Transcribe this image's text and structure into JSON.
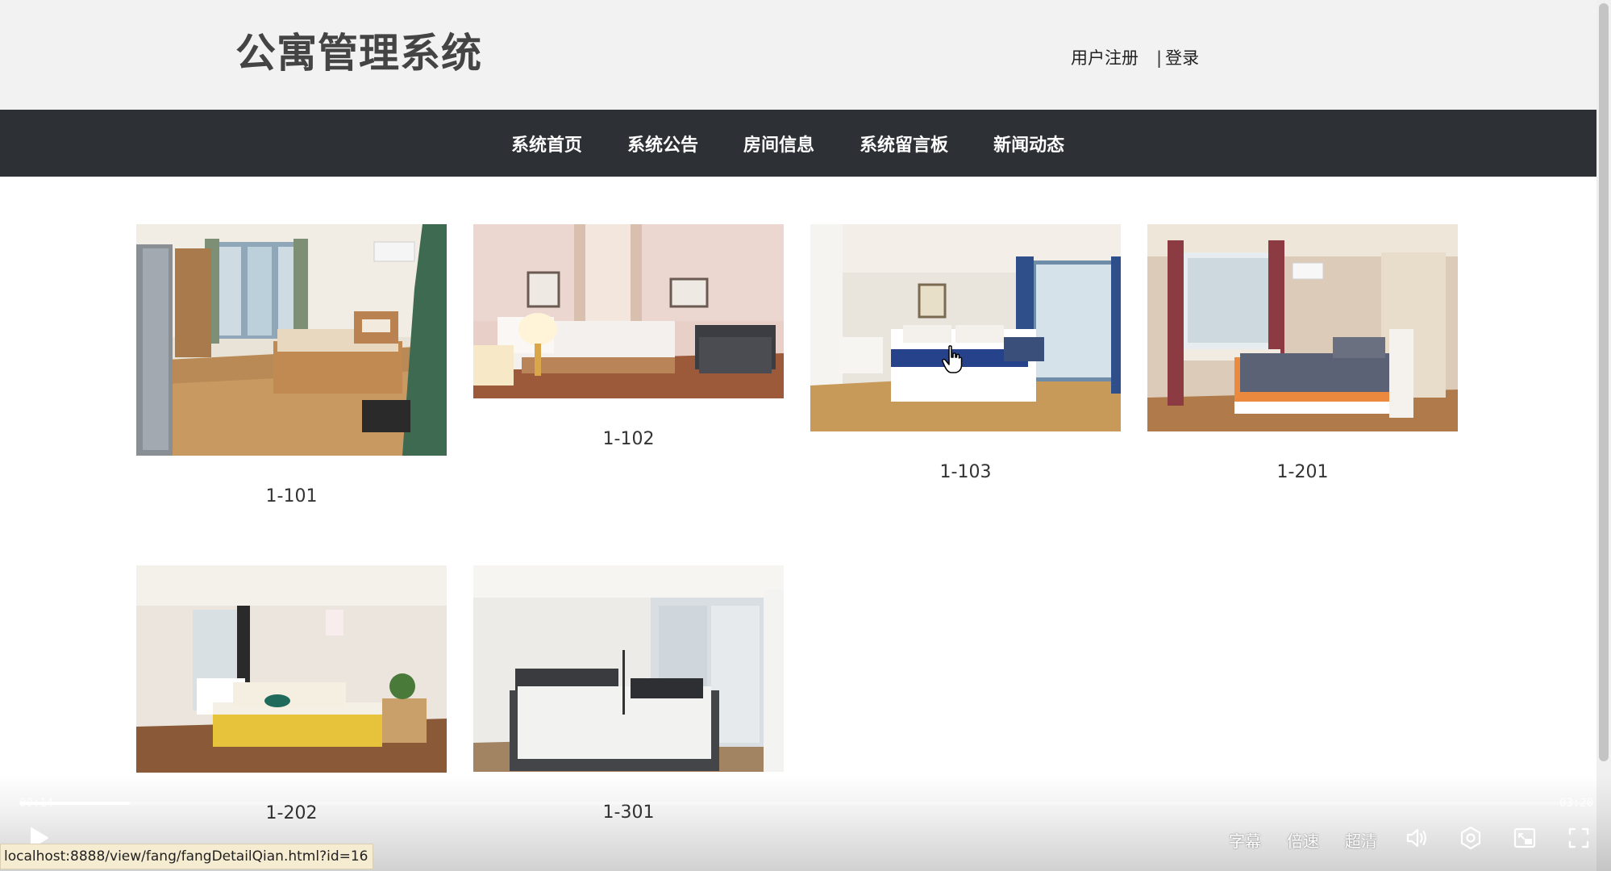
{
  "header": {
    "title": "公寓管理系统",
    "register_label": "用户注册",
    "separator": "|",
    "login_label": "登录"
  },
  "nav": {
    "items": [
      {
        "label": "系统首页"
      },
      {
        "label": "系统公告"
      },
      {
        "label": "房间信息"
      },
      {
        "label": "系统留言板"
      },
      {
        "label": "新闻动态"
      }
    ]
  },
  "rooms": [
    {
      "name": "1-101",
      "photo": "room-photo-1-101"
    },
    {
      "name": "1-102",
      "photo": "room-photo-1-102"
    },
    {
      "name": "1-103",
      "photo": "room-photo-1-103"
    },
    {
      "name": "1-201",
      "photo": "room-photo-1-201"
    },
    {
      "name": "1-202",
      "photo": "room-photo-1-202"
    },
    {
      "name": "1-301",
      "photo": "room-photo-1-301"
    }
  ],
  "video": {
    "time_current": "00:14",
    "time_total": "03:20",
    "progress": 0.07,
    "subtitle_label": "字幕",
    "speed_label": "倍速",
    "quality_label": "超清",
    "icons": [
      "play-icon",
      "volume-icon",
      "settings-icon",
      "picture-in-picture-icon",
      "fullscreen-icon"
    ]
  },
  "status_bar": {
    "url": "localhost:8888/view/fang/fangDetailQian.html?id=16"
  },
  "colors": {
    "header_bg": "#f2f2f2",
    "nav_bg": "#2d3035",
    "nav_text": "#ffffff",
    "status_bg": "#f6ecd2"
  }
}
